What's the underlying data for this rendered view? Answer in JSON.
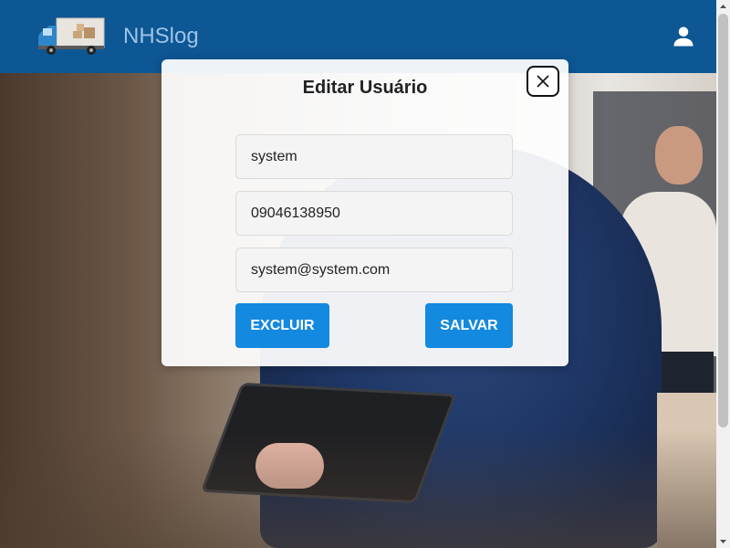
{
  "header": {
    "brand": "NHSlog",
    "logo_icon": "delivery-truck-icon",
    "user_icon": "person-icon",
    "color": "#0d5794"
  },
  "modal": {
    "title": "Editar Usuário",
    "close_icon": "close-icon",
    "fields": {
      "name": "system",
      "phone": "09046138950",
      "email": "system@system.com"
    },
    "buttons": {
      "delete": "EXCLUIR",
      "save": "SALVAR"
    },
    "button_color": "#1389e0"
  }
}
